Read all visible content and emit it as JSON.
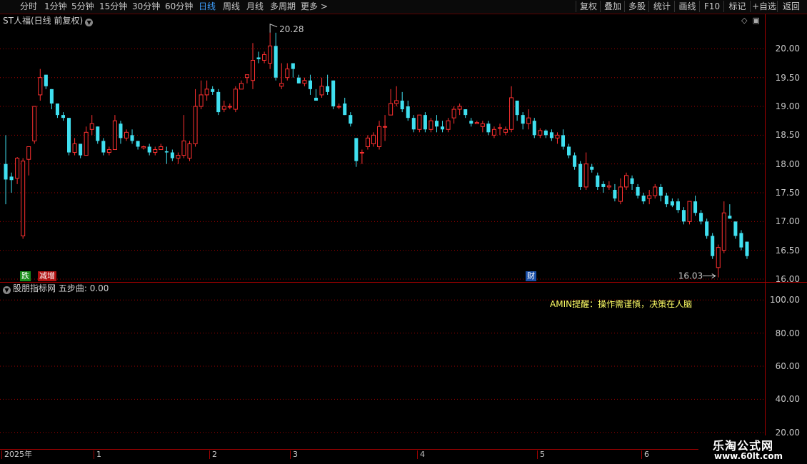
{
  "toolbar": {
    "periods": [
      "分时",
      "1分钟",
      "5分钟",
      "15分钟",
      "30分钟",
      "60分钟",
      "日线",
      "周线",
      "月线",
      "多周期",
      "更多 >"
    ],
    "active_period": "日线",
    "buttons": [
      "复权",
      "叠加",
      "多股",
      "统计",
      "画线",
      "F10",
      "标记",
      "+自选",
      "返回"
    ]
  },
  "main_chart": {
    "title": "ST人福(日线 前复权)",
    "price_ticks": [
      "20.00",
      "19.50",
      "19.00",
      "18.50",
      "18.00",
      "17.50",
      "17.00",
      "16.50",
      "16.00"
    ],
    "high_label": "20.28",
    "low_label": "16.03",
    "badges": [
      {
        "text": "跌",
        "color": "#1a8c1a",
        "fg": "#ffffff"
      },
      {
        "text": "减增",
        "color": "#b01010",
        "fg": "#ffffff"
      },
      {
        "text": "财",
        "color": "#1a4fa8",
        "fg": "#ffffff"
      }
    ]
  },
  "sub_chart": {
    "title": "股朋指标网",
    "series_label": "五步曲: 0.00",
    "warning": "AMIN提醒：操作需谨慎，决策在人脑",
    "ticks": [
      "100.00",
      "80.00",
      "60.00",
      "40.00",
      "20.00"
    ]
  },
  "time_axis": {
    "labels": [
      "2025年",
      "1",
      "2",
      "3",
      "4",
      "5",
      "6"
    ]
  },
  "watermark": {
    "name": "乐淘公式网",
    "url": "www.60lt.com"
  },
  "colors": {
    "up": "#ff3030",
    "down": "#40e0f0",
    "grid": "#a00000",
    "active": "#3fa0ff"
  },
  "chart_data": {
    "type": "candlestick",
    "ylim": [
      15.95,
      20.6
    ],
    "ohlc": [
      [
        18.0,
        17.73,
        18.5,
        17.3
      ],
      [
        17.78,
        17.72,
        17.85,
        17.5
      ],
      [
        17.75,
        18.1,
        18.12,
        17.65
      ],
      [
        16.75,
        18.05,
        18.1,
        16.7
      ],
      [
        18.08,
        18.3,
        18.3,
        17.8
      ],
      [
        18.4,
        19.0,
        19.0,
        18.35
      ],
      [
        19.2,
        19.5,
        19.65,
        19.1
      ],
      [
        19.55,
        19.35,
        19.55,
        19.3
      ],
      [
        19.3,
        19.05,
        19.3,
        18.95
      ],
      [
        19.05,
        18.85,
        19.05,
        18.8
      ],
      [
        18.85,
        18.8,
        18.9,
        18.75
      ],
      [
        18.8,
        18.2,
        18.8,
        18.15
      ],
      [
        18.2,
        18.35,
        18.45,
        18.15
      ],
      [
        18.35,
        18.15,
        18.35,
        18.1
      ],
      [
        18.15,
        18.55,
        18.65,
        18.15
      ],
      [
        18.6,
        18.7,
        18.85,
        18.5
      ],
      [
        18.65,
        18.4,
        18.65,
        18.35
      ],
      [
        18.4,
        18.2,
        18.45,
        18.15
      ],
      [
        18.2,
        18.25,
        18.3,
        18.15
      ],
      [
        18.25,
        18.75,
        18.85,
        18.25
      ],
      [
        18.7,
        18.45,
        18.75,
        18.35
      ],
      [
        18.45,
        18.55,
        18.6,
        18.4
      ],
      [
        18.5,
        18.4,
        18.6,
        18.35
      ],
      [
        18.4,
        18.3,
        18.4,
        18.25
      ],
      [
        18.28,
        18.3,
        18.32,
        18.25
      ],
      [
        18.3,
        18.2,
        18.35,
        18.15
      ],
      [
        18.2,
        18.25,
        18.3,
        18.15
      ],
      [
        18.25,
        18.3,
        18.35,
        18.25
      ],
      [
        18.22,
        18.2,
        18.3,
        18.0
      ],
      [
        18.2,
        18.1,
        18.25,
        18.05
      ],
      [
        18.1,
        18.15,
        18.2,
        18.0
      ],
      [
        18.15,
        18.4,
        18.85,
        18.1
      ],
      [
        18.1,
        18.35,
        18.4,
        18.05
      ],
      [
        18.35,
        19.0,
        19.3,
        18.3
      ],
      [
        19.0,
        19.2,
        19.45,
        18.95
      ],
      [
        19.2,
        19.3,
        19.45,
        19.1
      ],
      [
        19.3,
        19.25,
        19.35,
        19.2
      ],
      [
        19.25,
        18.9,
        19.3,
        18.85
      ],
      [
        18.95,
        19.0,
        19.1,
        18.9
      ],
      [
        19.0,
        19.0,
        19.05,
        18.95
      ],
      [
        18.95,
        19.3,
        19.35,
        18.9
      ],
      [
        19.3,
        19.4,
        19.45,
        19.3
      ],
      [
        19.5,
        19.55,
        19.55,
        19.4
      ],
      [
        19.45,
        19.8,
        20.1,
        19.3
      ],
      [
        19.85,
        19.82,
        19.95,
        19.75
      ],
      [
        19.8,
        19.9,
        19.95,
        19.75
      ],
      [
        19.75,
        20.05,
        20.28,
        19.65
      ],
      [
        20.05,
        19.5,
        20.28,
        19.45
      ],
      [
        19.35,
        19.4,
        19.75,
        19.3
      ],
      [
        19.5,
        19.65,
        19.75,
        19.45
      ],
      [
        19.75,
        19.65,
        19.75,
        19.5
      ],
      [
        19.5,
        19.4,
        19.55,
        19.4
      ],
      [
        19.4,
        19.45,
        19.5,
        19.35
      ],
      [
        19.45,
        19.3,
        19.55,
        19.2
      ],
      [
        19.15,
        19.1,
        19.3,
        19.1
      ],
      [
        19.2,
        19.35,
        19.5,
        19.15
      ],
      [
        19.35,
        19.25,
        19.55,
        19.2
      ],
      [
        19.45,
        19.0,
        19.45,
        18.95
      ],
      [
        19.0,
        19.0,
        19.05,
        18.95
      ],
      [
        19.05,
        18.85,
        19.15,
        18.85
      ],
      [
        18.85,
        18.7,
        18.9,
        18.65
      ],
      [
        18.45,
        18.05,
        18.45,
        17.95
      ],
      [
        18.2,
        18.2,
        18.25,
        18.0
      ],
      [
        18.3,
        18.45,
        18.5,
        18.25
      ],
      [
        18.35,
        18.5,
        18.55,
        18.3
      ],
      [
        18.3,
        18.65,
        18.75,
        18.25
      ],
      [
        18.65,
        18.65,
        18.85,
        18.4
      ],
      [
        18.85,
        19.05,
        19.3,
        18.85
      ],
      [
        19.05,
        19.1,
        19.35,
        19.0
      ],
      [
        19.1,
        18.95,
        19.25,
        18.9
      ],
      [
        19.0,
        18.8,
        19.1,
        18.75
      ],
      [
        18.8,
        18.6,
        18.85,
        18.55
      ],
      [
        18.6,
        18.85,
        18.85,
        18.55
      ],
      [
        18.85,
        18.6,
        18.9,
        18.55
      ],
      [
        18.6,
        18.75,
        18.8,
        18.55
      ],
      [
        18.75,
        18.65,
        18.85,
        18.55
      ],
      [
        18.65,
        18.6,
        18.75,
        18.55
      ],
      [
        18.6,
        18.75,
        18.8,
        18.55
      ],
      [
        18.8,
        18.95,
        19.0,
        18.7
      ],
      [
        18.95,
        19.0,
        19.05,
        18.85
      ],
      [
        18.95,
        18.85,
        18.95,
        18.8
      ],
      [
        18.75,
        18.7,
        18.8,
        18.65
      ],
      [
        18.7,
        18.72,
        18.75,
        18.7
      ],
      [
        18.65,
        18.7,
        18.75,
        18.55
      ],
      [
        18.7,
        18.55,
        18.75,
        18.5
      ],
      [
        18.5,
        18.6,
        18.65,
        18.45
      ],
      [
        18.62,
        18.63,
        18.7,
        18.5
      ],
      [
        18.55,
        18.6,
        18.65,
        18.5
      ],
      [
        18.6,
        19.15,
        19.35,
        18.55
      ],
      [
        19.1,
        18.85,
        19.1,
        18.75
      ],
      [
        18.85,
        18.7,
        18.9,
        18.6
      ],
      [
        18.7,
        18.8,
        18.95,
        18.6
      ],
      [
        18.75,
        18.5,
        18.8,
        18.45
      ],
      [
        18.5,
        18.58,
        18.62,
        18.45
      ],
      [
        18.58,
        18.5,
        18.6,
        18.45
      ],
      [
        18.55,
        18.45,
        18.6,
        18.4
      ],
      [
        18.45,
        18.5,
        18.55,
        18.35
      ],
      [
        18.5,
        18.3,
        18.6,
        18.25
      ],
      [
        18.3,
        18.15,
        18.35,
        18.1
      ],
      [
        18.15,
        17.95,
        18.2,
        17.9
      ],
      [
        18.0,
        17.6,
        18.05,
        17.55
      ],
      [
        17.6,
        18.0,
        18.2,
        17.55
      ],
      [
        17.95,
        17.9,
        18.0,
        17.85
      ],
      [
        17.8,
        17.6,
        17.85,
        17.55
      ],
      [
        17.65,
        17.6,
        17.7,
        17.5
      ],
      [
        17.6,
        17.62,
        17.7,
        17.55
      ],
      [
        17.55,
        17.4,
        17.65,
        17.35
      ],
      [
        17.35,
        17.6,
        17.75,
        17.3
      ],
      [
        17.6,
        17.8,
        17.85,
        17.55
      ],
      [
        17.75,
        17.65,
        17.8,
        17.55
      ],
      [
        17.6,
        17.45,
        17.65,
        17.4
      ],
      [
        17.45,
        17.35,
        17.5,
        17.3
      ],
      [
        17.4,
        17.45,
        17.55,
        17.3
      ],
      [
        17.45,
        17.6,
        17.65,
        17.4
      ],
      [
        17.6,
        17.45,
        17.65,
        17.35
      ],
      [
        17.45,
        17.3,
        17.5,
        17.25
      ],
      [
        17.35,
        17.28,
        17.4,
        17.25
      ],
      [
        17.35,
        17.2,
        17.4,
        17.15
      ],
      [
        17.2,
        17.0,
        17.25,
        16.95
      ],
      [
        17.0,
        17.35,
        17.35,
        16.95
      ],
      [
        17.35,
        17.15,
        17.45,
        17.1
      ],
      [
        17.15,
        17.0,
        17.2,
        16.95
      ],
      [
        17.0,
        16.75,
        17.05,
        16.7
      ],
      [
        16.75,
        16.4,
        16.8,
        16.35
      ],
      [
        16.2,
        16.55,
        16.6,
        16.03
      ],
      [
        16.5,
        17.15,
        17.35,
        16.45
      ],
      [
        17.1,
        17.05,
        17.3,
        17.05
      ],
      [
        17.0,
        16.75,
        17.0,
        16.7
      ],
      [
        16.8,
        16.55,
        16.85,
        16.5
      ],
      [
        16.65,
        16.4,
        16.65,
        16.35
      ]
    ],
    "sub_series_name": "五步曲",
    "sub_value": 0.0,
    "sub_ylim": [
      10,
      110
    ]
  }
}
